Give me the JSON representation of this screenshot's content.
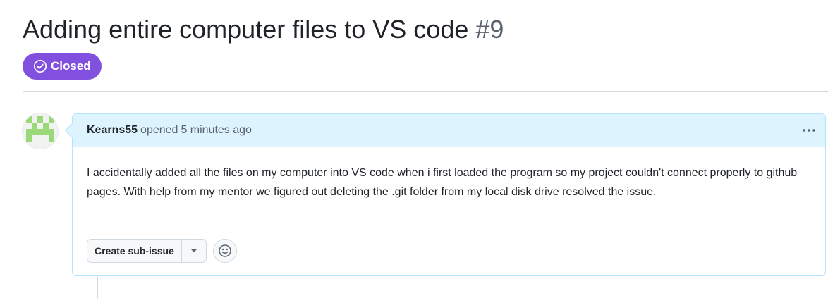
{
  "issue": {
    "title": "Adding entire computer files to VS code",
    "number": "#9",
    "state": {
      "label": "Closed",
      "icon": "check-circle-icon",
      "color": "#8250df"
    }
  },
  "comment": {
    "author": "Kearns55",
    "action": "opened",
    "timestamp": "5 minutes ago",
    "header_color": "#ddf4ff",
    "border_color": "#b6e3ff",
    "body": "I accidentally added all the files on my computer into VS code when i first loaded the program so my project couldn't connect properly to github pages. With help from my mentor we figured out deleting the .git folder from my local disk drive resolved the issue.",
    "menu_icon": "kebab-horizontal-icon",
    "actions": {
      "create_sub_issue_label": "Create sub-issue",
      "dropdown_icon": "triangle-down-icon",
      "reaction_icon": "smiley-icon"
    }
  },
  "avatar": {
    "icon": "identicon-avatar",
    "color": "#9bd87a"
  }
}
